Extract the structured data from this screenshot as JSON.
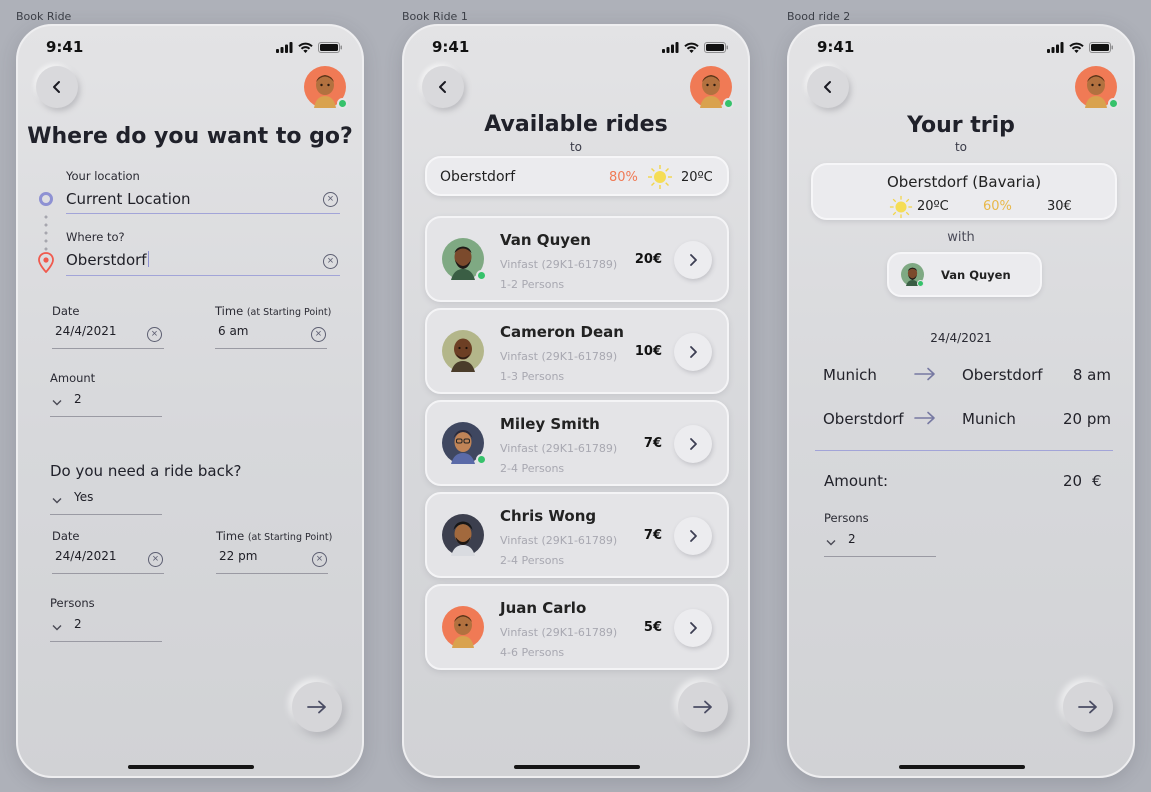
{
  "frames": [
    {
      "label": "Book Ride"
    },
    {
      "label": "Book Ride 1"
    },
    {
      "label": "Bood ride 2"
    }
  ],
  "status": {
    "time": "9:41"
  },
  "colors": {
    "accent_purple": "#8e91d3",
    "pin_red": "#f05a4e",
    "orange": "#f07a55",
    "yellow": "#e8b84a",
    "online_green": "#36c26b"
  },
  "book": {
    "title": "Where do you want to go?",
    "your_location_label": "Your location",
    "your_location_value": "Current Location",
    "where_to_label": "Where to?",
    "where_to_value": "Oberstdorf",
    "date_label": "Date",
    "date_value": "24/4/2021",
    "time_label": "Time",
    "time_hint": "(at Starting Point)",
    "time_value": "6 am",
    "amount_label": "Amount",
    "amount_value": "2",
    "ride_back_question": "Do you need a ride back?",
    "ride_back_value": "Yes",
    "return_date_label": "Date",
    "return_date_value": "24/4/2021",
    "return_time_label": "Time",
    "return_time_hint": "(at Starting Point)",
    "return_time_value": "22 pm",
    "persons_label": "Persons",
    "persons_value": "2"
  },
  "rides": {
    "title": "Available rides",
    "to_label": "to",
    "destination": "Oberstdorf",
    "rain_chance": "80%",
    "temperature": "20ºC",
    "list": [
      {
        "name": "Van Quyen",
        "car": "Vinfast (29K1-61789)",
        "persons": "1-2 Persons",
        "price": "20€"
      },
      {
        "name": "Cameron Dean",
        "car": "Vinfast (29K1-61789)",
        "persons": "1-3 Persons",
        "price": "10€"
      },
      {
        "name": "Miley Smith",
        "car": "Vinfast (29K1-61789)",
        "persons": "2-4 Persons",
        "price": "7€"
      },
      {
        "name": "Chris Wong",
        "car": "Vinfast (29K1-61789)",
        "persons": "2-4 Persons",
        "price": "7€"
      },
      {
        "name": "Juan Carlo",
        "car": "Vinfast (29K1-61789)",
        "persons": "4-6 Persons",
        "price": "5€"
      }
    ]
  },
  "trip": {
    "title": "Your trip",
    "to_label": "to",
    "destination": "Oberstdorf (Bavaria)",
    "temperature": "20ºC",
    "rain_chance": "60%",
    "cost": "30€",
    "with_label": "with",
    "driver": "Van Quyen",
    "date": "24/4/2021",
    "legs": [
      {
        "from": "Munich",
        "to": "Oberstdorf",
        "time": "8 am"
      },
      {
        "from": "Oberstdorf",
        "to": "Munich",
        "time": "20 pm"
      }
    ],
    "amount_label": "Amount:",
    "amount_value": "20",
    "amount_currency": "€",
    "persons_label": "Persons",
    "persons_value": "2"
  }
}
